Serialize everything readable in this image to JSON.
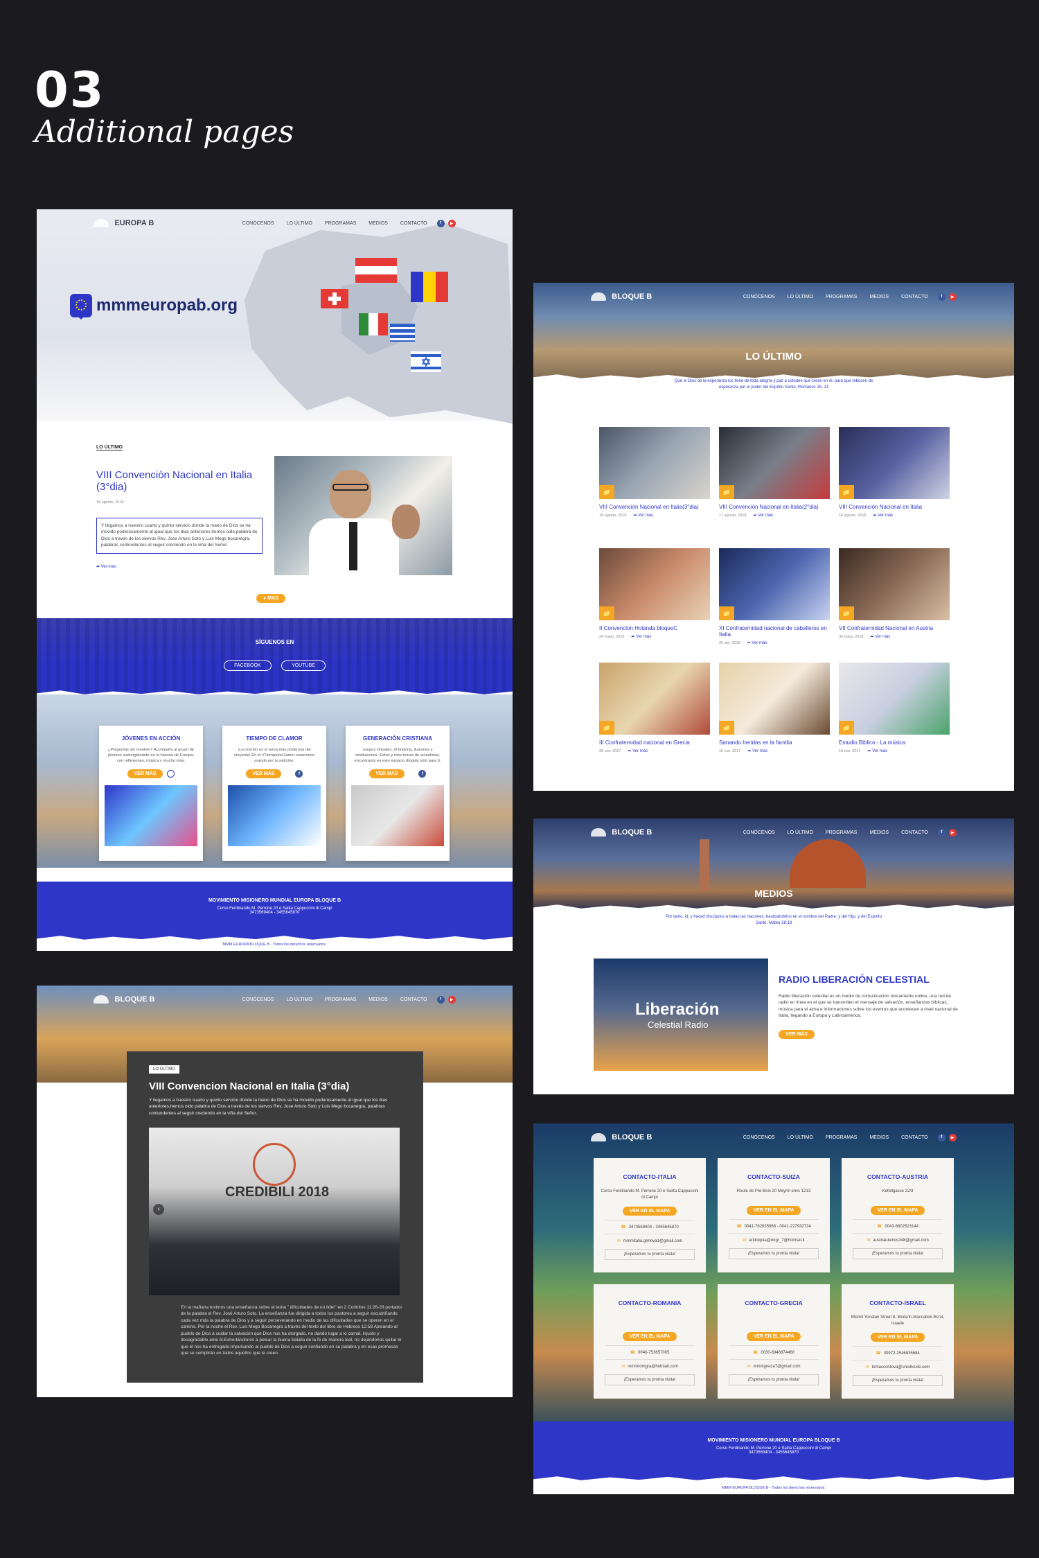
{
  "showcase": {
    "number": "03",
    "subtitle": "Additional pages"
  },
  "site": {
    "brand_home": "EUROPA B",
    "brand": "BLOQUE B",
    "menu": [
      "CONÓCENOS",
      "LO ÚLTIMO",
      "PROGRAMAS",
      "MEDIOS",
      "CONTACTO"
    ],
    "social": {
      "facebook": "f",
      "youtube": "▶"
    },
    "footer": {
      "org": "MOVIMIENTO MISIONERO MUNDIAL EUROPA BLOQUE B",
      "address": "Corso Ferdinando M. Perrone 20 e Salita Cappuccini di Campi",
      "phones": "3473569404 - 3455645870",
      "copyright": "MMM EUROPA BLOQUE B - Todos los derechos reservados."
    }
  },
  "home": {
    "domain": "mmmeuropab.org",
    "latest_label": "LO ÚLTIMO",
    "post_title": "VIII Convenciòn Nacional en Italia (3°dia)",
    "post_date": "18 agosto, 2018",
    "post_excerpt": "Y llegamos a nuestro cuarto y quinto servicio donde la mano de Dios se ha movido poderosamente al igual que los dias anteriores,hemos oido palabra de Dios a través de los siervos Rev. Jose Arturo Soto y Luis Mego bocanegra, palabras contundentes al seguir creciendo en la viña del Señor.",
    "post_more": "Ver más",
    "more_button": "MÁS",
    "follow_title": "SÍGUENOS EN",
    "follow_buttons": [
      "FACEBOOK",
      "YOUTUBE"
    ],
    "programs": [
      {
        "title": "JÓVENES EN ACCIÓN",
        "desc": "¿Preguntas sin resolver? Acompaña al grupo de jóvenes sumergiéndote en la historia de Europa, con reflexiones, música y mucho más.",
        "button": "VER MÁS"
      },
      {
        "title": "TIEMPO DE CLAMOR",
        "desc": "¡La oración es el arma más poderosa del creyente! En el #TiempodeClamor estaremos orando por tu petición.",
        "button": "VER MÁS"
      },
      {
        "title": "GENERACIÓN CRISTIANA",
        "desc": "Juegos virtuales, el bullying, ilusiones y desilusiones. Estos y más temas de actualidad, encontrarás en este espacio dirigido sólo para ti.",
        "button": "VER MÁS"
      }
    ]
  },
  "latest": {
    "title": "LO ÚLTIMO",
    "verse": "Que el Dios de la esperanza los llene de toda alegría y paz a ustedes que creen en él, para que rebosen de esperanza por el poder del Espíritu Santo. Romanos 15: 13",
    "more": "Ver más",
    "posts": [
      {
        "title": "VIII Convención Nacional en Italia(3°dia)",
        "date": "18 agosto, 2018"
      },
      {
        "title": "VIII Convención Nacional en Italia(2°dia)",
        "date": "17 agosto, 2018"
      },
      {
        "title": "VIII Convención Nacional en Italia",
        "date": "16 agosto, 2018"
      },
      {
        "title": "II Convencion Holanda bloqueC",
        "date": "24 mayo, 2018"
      },
      {
        "title": "XI Confraternidad nacional de caballeros en Italia",
        "date": "20 abr, 2018"
      },
      {
        "title": "VII Confraternidad Nacional en Austria",
        "date": "30 marg, 2018"
      },
      {
        "title": "III Confraternidad nacional en Grecia",
        "date": "26 nov, 2017"
      },
      {
        "title": "Sanando heridas en la familia",
        "date": "19 nov, 2017"
      },
      {
        "title": "Estudio Biblico - La música",
        "date": "16 nov, 2017"
      }
    ]
  },
  "media": {
    "title": "MEDIOS",
    "verse": "Por tanto, id, y haced discípulos a todas las naciones, bautizándolos en el nombre del Padre, y del Hijo, y del Espíritu Santo. Mateo 28:19",
    "radio_logo": "Liberación",
    "radio_logo_sub": "Celestial Radio",
    "radio_title": "RADIO LIBERACIÓN CELESTIAL",
    "radio_desc": "Radio liberación celestial es un medio de comunicación únicamente online, una red de radio en línea en el que se transmiten el mensaje de salvación, enseñanzas bíblicas, música para el alma e informaciones sobre los eventos que acontecen a nivel nacional de Italia, llegando a Europa y Latinoamérica.",
    "radio_button": "VER MÁS"
  },
  "article": {
    "tag": "LO ÚLTIMO",
    "title": "VIII Convencion Nacional en Italia (3°dia)",
    "excerpt": "Y llegamos a nuestro cuarto y quinto servicio donde la mano de Dios se ha movido poderosamente al igual que los dias anteriores,hemos oido palabra de Dios a través de los siervos Rev. Jose Arturo Soto y Luis Mego bocanegra, palabras contundentes al seguir creciendo en la viña del Señor.",
    "image_text": "CREDIBILI 2018",
    "body": "En la mañana tuvimos una enseñanza sobre el tema \" dificultades de un lider\" en 2 Corintios 11:26-28 portador de la palabra el Rev. José Arturo Soto. La enseñanza fue dirigida a todos los pastores a seguir escudriñando cada vez más la palabra de Dios y a seguir perseverando en medio de las dificultades que se operen en el camino. Por la noche el Rev. Luis Mego Bocanegra a través del texto del libro de Hebreos 12:58 Apelando al pueblo de Dios a cuidar la salvación que Dios nos ha otorgado, no dando lugar a lo carnal, injusto y desagradable ante él.Exhortándonos a pelear la buena batalla de la fe de manera leal, no dejándonos quitar lo que él nos ha entregado.Impulsando al pueblo de Dios a seguir confiando en su palabra y en esas promesas que se cumplirán en todos aquellos que le creen."
  },
  "contact": {
    "map_button": "VER EN EL MAPA",
    "hope": "¡Esperamos tu pronta visita!",
    "cards": [
      {
        "title": "CONTACTO-ITALIA",
        "address": "Corso Ferdinando M. Perrone 20 e Salita Cappuccini di Campi",
        "phone": "3473569404 - 3455645870",
        "email": "mmmitalia.genova1@gmail.com"
      },
      {
        "title": "CONTACTO-SUIZA",
        "address": "Route de Pré-Bois 20 Meyrin envs 1213",
        "phone": "0041-762935966 - 0041-227932734",
        "email": "anticiquia@ringr_7@hotmail.it"
      },
      {
        "title": "CONTACTO-AUSTRIA",
        "address": "Kettelgasse 22/3",
        "phone": "0043-6602523144",
        "email": "austriaiulerios348@gmail.com"
      },
      {
        "title": "CONTACTO-ROMANIA",
        "address": "",
        "phone": "0040-753657005",
        "email": "mmmromgra@hotmail.com"
      },
      {
        "title": "CONTACTO-GRECIA",
        "address": "",
        "phone": "0030-6946874468",
        "email": "mmmgrecia7@gmail.com"
      },
      {
        "title": "CONTACTO-ISRAEL",
        "address": "Mishol Yonatan Street 8, Moda'in-Maccabim-Re'ut, Israele",
        "phone": "00972-2546835684",
        "email": "tomascordova@uniobcuile.com"
      }
    ]
  },
  "colors": {
    "accent": "#2e36c8",
    "button": "#f5a623",
    "background": "#1b1a1f"
  }
}
